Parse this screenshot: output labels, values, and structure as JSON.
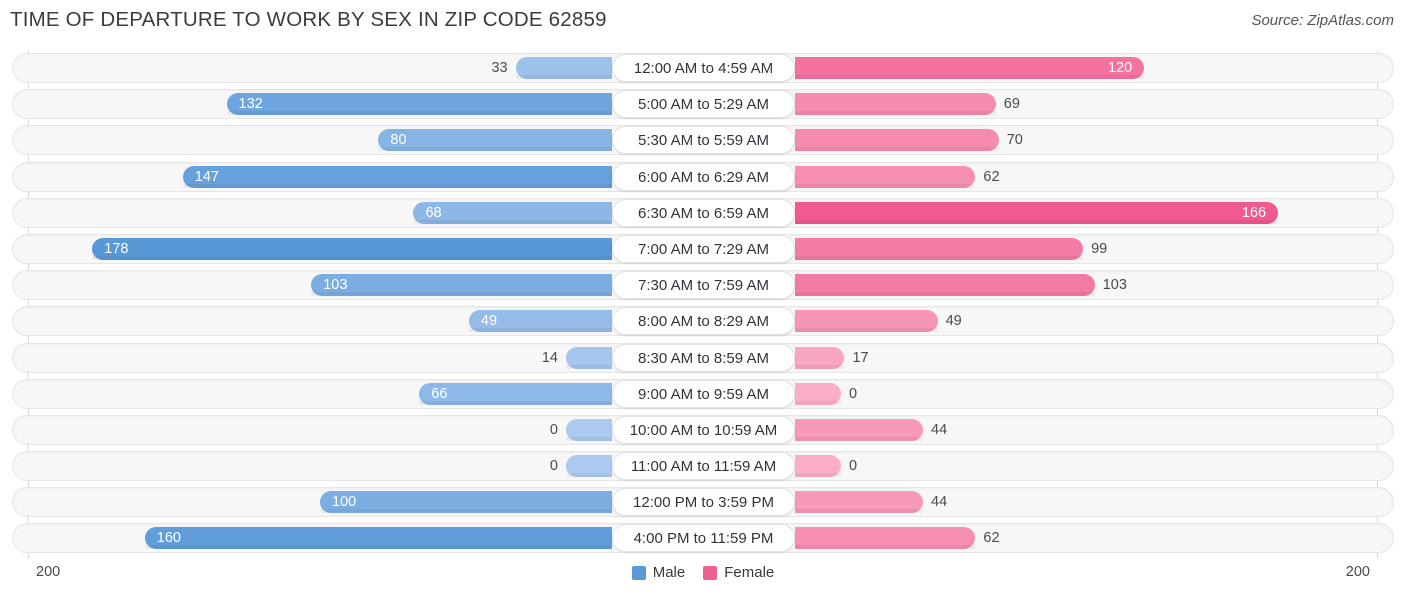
{
  "header": {
    "title": "TIME OF DEPARTURE TO WORK BY SEX IN ZIP CODE 62859",
    "source": "Source: ZipAtlas.com"
  },
  "footer": {
    "tick_left": "200",
    "tick_right": "200",
    "legend": [
      {
        "label": "Male",
        "color": "#5b9bd5"
      },
      {
        "label": "Female",
        "color": "#f0608f"
      }
    ]
  },
  "chart_data": {
    "type": "bar",
    "title": "TIME OF DEPARTURE TO WORK BY SEX IN ZIP CODE 62859",
    "subtitle": "",
    "orientation": "horizontal-diverging",
    "xlabel": "",
    "ylabel": "",
    "xlim": [
      200,
      200
    ],
    "grid": false,
    "legend_position": "bottom-center",
    "categories": [
      "12:00 AM to 4:59 AM",
      "5:00 AM to 5:29 AM",
      "5:30 AM to 5:59 AM",
      "6:00 AM to 6:29 AM",
      "6:30 AM to 6:59 AM",
      "7:00 AM to 7:29 AM",
      "7:30 AM to 7:59 AM",
      "8:00 AM to 8:29 AM",
      "8:30 AM to 8:59 AM",
      "9:00 AM to 9:59 AM",
      "10:00 AM to 10:59 AM",
      "11:00 AM to 11:59 AM",
      "12:00 PM to 3:59 PM",
      "4:00 PM to 11:59 PM"
    ],
    "series": [
      {
        "name": "Male",
        "color": "#5b9bd5",
        "values": [
          33,
          132,
          80,
          147,
          68,
          178,
          103,
          49,
          14,
          66,
          0,
          0,
          100,
          160
        ]
      },
      {
        "name": "Female",
        "color": "#f0608f",
        "values": [
          120,
          69,
          70,
          62,
          166,
          99,
          103,
          49,
          17,
          0,
          44,
          0,
          44,
          62
        ]
      }
    ],
    "rows": [
      {
        "category": "12:00 AM to 4:59 AM",
        "male": 33,
        "female": 120
      },
      {
        "category": "5:00 AM to 5:29 AM",
        "male": 132,
        "female": 69
      },
      {
        "category": "5:30 AM to 5:59 AM",
        "male": 80,
        "female": 70
      },
      {
        "category": "6:00 AM to 6:29 AM",
        "male": 147,
        "female": 62
      },
      {
        "category": "6:30 AM to 6:59 AM",
        "male": 68,
        "female": 166
      },
      {
        "category": "7:00 AM to 7:29 AM",
        "male": 178,
        "female": 99
      },
      {
        "category": "7:30 AM to 7:59 AM",
        "male": 103,
        "female": 103
      },
      {
        "category": "8:00 AM to 8:29 AM",
        "male": 49,
        "female": 49
      },
      {
        "category": "8:30 AM to 8:59 AM",
        "male": 14,
        "female": 17
      },
      {
        "category": "9:00 AM to 9:59 AM",
        "male": 66,
        "female": 0
      },
      {
        "category": "10:00 AM to 10:59 AM",
        "male": 0,
        "female": 44
      },
      {
        "category": "11:00 AM to 11:59 AM",
        "male": 0,
        "female": 0
      },
      {
        "category": "12:00 PM to 3:59 PM",
        "male": 100,
        "female": 44
      },
      {
        "category": "4:00 PM to 11:59 PM",
        "male": 160,
        "female": 62
      }
    ]
  }
}
